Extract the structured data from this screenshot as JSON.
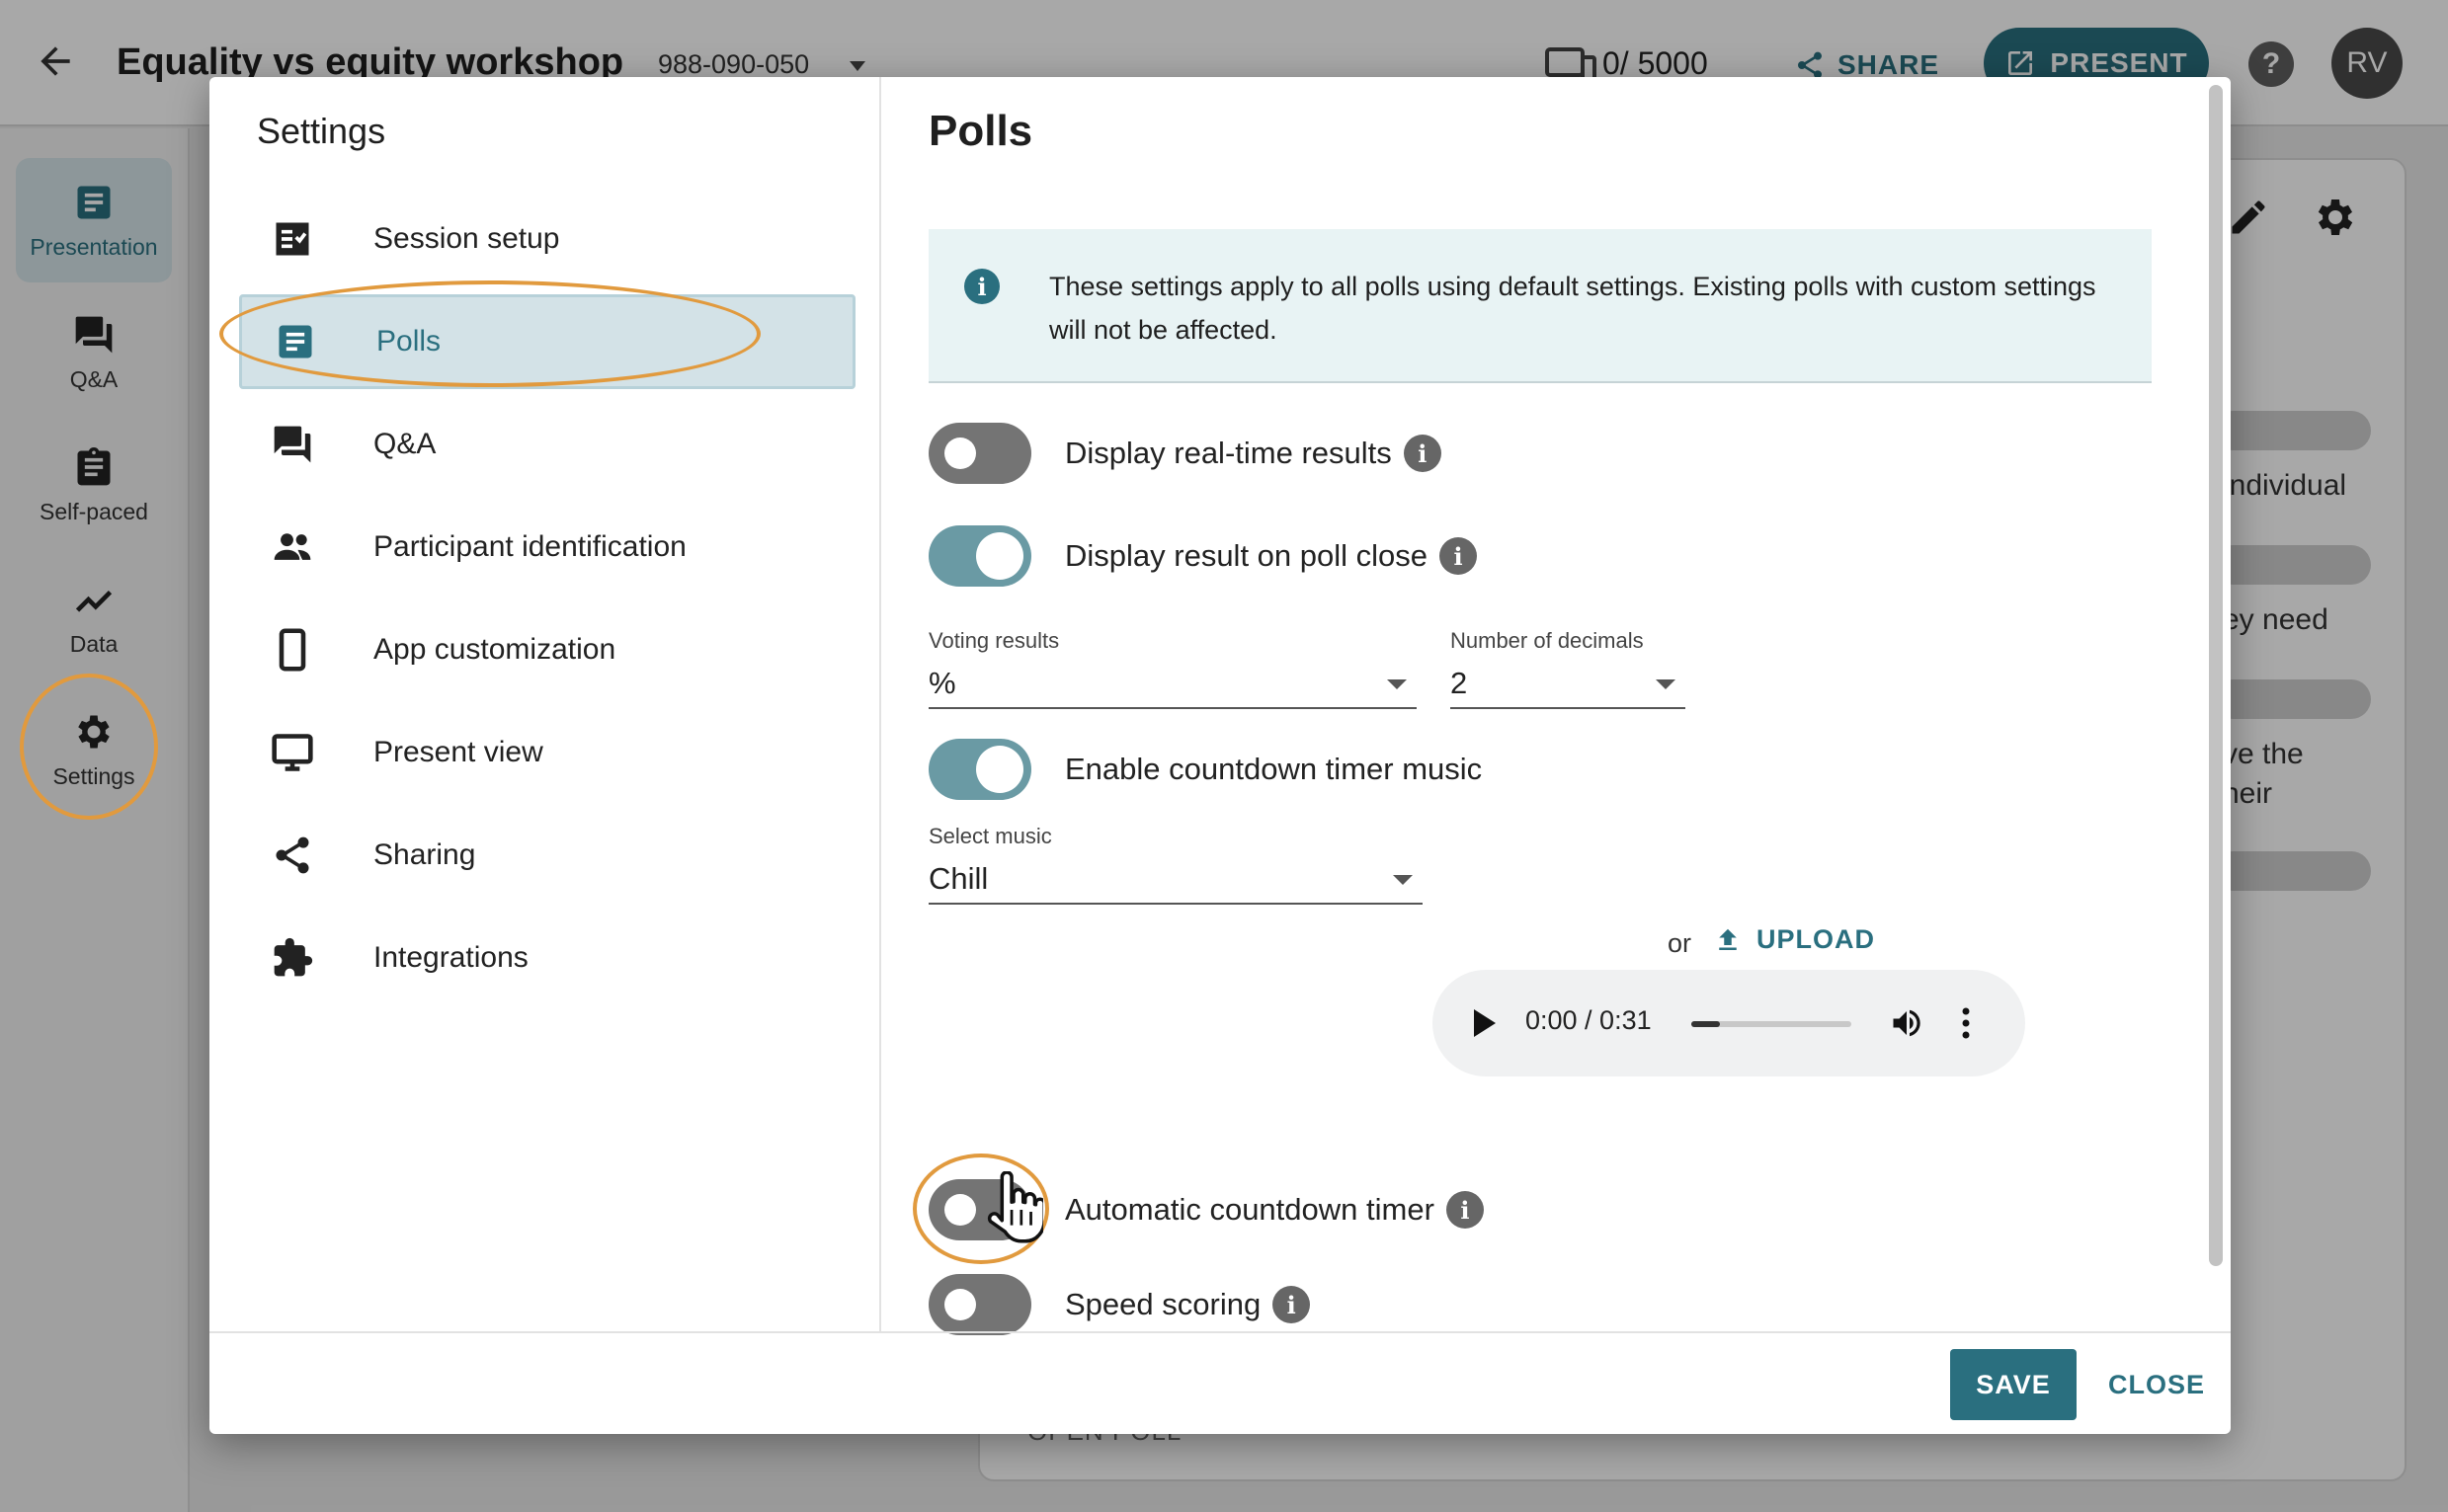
{
  "header": {
    "title": "Equality vs equity workshop",
    "session_code": "988-090-050",
    "participants": "0/ 5000",
    "share_label": "SHARE",
    "present_label": "PRESENT",
    "help_label": "?",
    "avatar_initials": "RV"
  },
  "rail": {
    "items": [
      {
        "label": "Presentation",
        "icon": "presentation-icon"
      },
      {
        "label": "Q&A",
        "icon": "qa-icon"
      },
      {
        "label": "Self-paced",
        "icon": "clipboard-icon"
      },
      {
        "label": "Data",
        "icon": "chart-icon"
      },
      {
        "label": "Settings",
        "icon": "gear-icon"
      }
    ]
  },
  "background": {
    "snippets": [
      "individual",
      "ey need",
      "ve the",
      "heir"
    ],
    "open_poll": "OPEN POLL"
  },
  "dialog": {
    "title": "Settings",
    "nav": [
      {
        "label": "Session setup",
        "icon": "checklist-icon"
      },
      {
        "label": "Polls",
        "icon": "poll-icon"
      },
      {
        "label": "Q&A",
        "icon": "qa-icon"
      },
      {
        "label": "Participant identification",
        "icon": "people-icon"
      },
      {
        "label": "App customization",
        "icon": "phone-icon"
      },
      {
        "label": "Present view",
        "icon": "monitor-icon"
      },
      {
        "label": "Sharing",
        "icon": "share-icon"
      },
      {
        "label": "Integrations",
        "icon": "puzzle-icon"
      }
    ],
    "selected_nav": "Polls",
    "panel": {
      "title": "Polls",
      "info": "These settings apply to all polls using default settings. Existing polls with custom settings will not be affected.",
      "toggles": {
        "realtime": {
          "label": "Display real-time results",
          "on": false
        },
        "result_on_close": {
          "label": "Display result on poll close",
          "on": true
        },
        "countdown_music": {
          "label": "Enable countdown timer music",
          "on": true
        },
        "auto_countdown": {
          "label": "Automatic countdown timer",
          "on": false
        },
        "speed_scoring": {
          "label": "Speed scoring",
          "on": false
        }
      },
      "voting_results": {
        "label": "Voting results",
        "value": "%"
      },
      "decimals": {
        "label": "Number of decimals",
        "value": "2"
      },
      "music": {
        "label": "Select music",
        "value": "Chill"
      },
      "or_text": "or",
      "upload_label": "UPLOAD",
      "audio": {
        "time": "0:00 / 0:31",
        "progress": 0.18
      },
      "info_badge": "i"
    },
    "save_label": "SAVE",
    "close_label": "CLOSE"
  },
  "colors": {
    "accent": "#2a6f7f",
    "highlight": "#e19a3e",
    "toggle_on": "#6a9aa4",
    "toggle_off": "#747474"
  }
}
